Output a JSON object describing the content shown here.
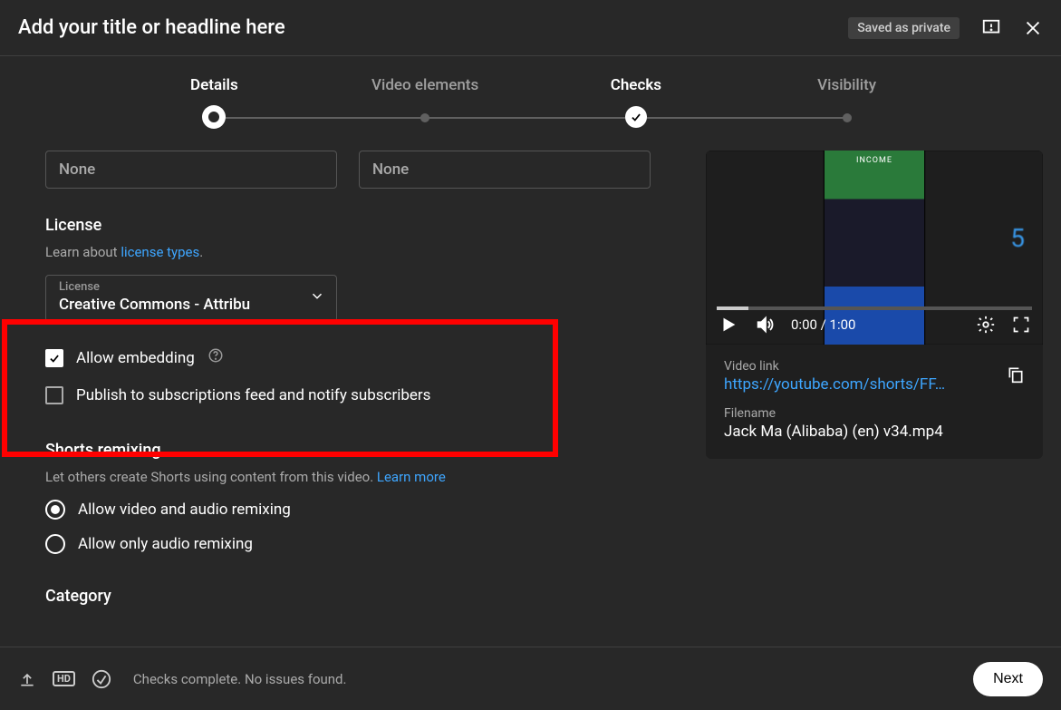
{
  "header": {
    "title": "Add your title or headline here",
    "save_status": "Saved as private"
  },
  "stepper": {
    "steps": [
      {
        "label": "Details"
      },
      {
        "label": "Video elements"
      },
      {
        "label": "Checks"
      },
      {
        "label": "Visibility"
      }
    ]
  },
  "selects": {
    "box1_value": "None",
    "box2_value": "None"
  },
  "license": {
    "heading": "License",
    "sub_prefix": "Learn about ",
    "sub_link": "license types",
    "sub_suffix": ".",
    "field_label": "License",
    "field_value": "Creative Commons - Attribu"
  },
  "checkboxes": {
    "embed_label": "Allow embedding",
    "publish_label": "Publish to subscriptions feed and notify subscribers"
  },
  "remix": {
    "heading": "Shorts remixing",
    "sub": "Let others create Shorts using content from this video. ",
    "learn_more": "Learn more",
    "opt1": "Allow video and audio remixing",
    "opt2": "Allow only audio remixing"
  },
  "category": {
    "heading": "Category"
  },
  "preview": {
    "time": "0:00 / 1:00",
    "blur_r_text": "5",
    "link_label": "Video link",
    "link_value": "https://youtube.com/shorts/FF…",
    "filename_label": "Filename",
    "filename_value": "Jack Ma (Alibaba) (en) v34.mp4"
  },
  "footer": {
    "status": "Checks complete. No issues found.",
    "next_label": "Next",
    "hd_badge": "HD"
  }
}
